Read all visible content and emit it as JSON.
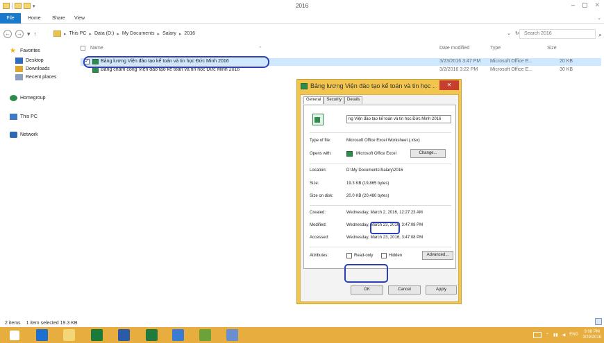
{
  "window": {
    "title": "2016",
    "minimize": "–",
    "maximize": "▢",
    "close": "✕"
  },
  "ribbon": {
    "file": "File",
    "home": "Home",
    "share": "Share",
    "view": "View",
    "expand": "⌄"
  },
  "address": {
    "crumbs": [
      "This PC",
      "Data (D:)",
      "My Documents",
      "Salary",
      "2016"
    ],
    "separator": "▸",
    "dropdown": "⌄",
    "refresh": "↻",
    "search_placeholder": "Search 2016"
  },
  "sidebar": {
    "favorites": "Favorites",
    "desktop": "Desktop",
    "downloads": "Downloads",
    "recent": "Recent places",
    "homegroup": "Homegroup",
    "thispc": "This PC",
    "network": "Network"
  },
  "columns": {
    "name": "Name",
    "date": "Date modified",
    "type": "Type",
    "size": "Size"
  },
  "files": [
    {
      "name": "Bảng lương Viện đào tạo kế toán và tin học Đức Minh 2016",
      "date": "3/23/2016 3:47 PM",
      "type": "Microsoft Office E...",
      "size": "20 KB",
      "checked": true
    },
    {
      "name": "Bảng chấm công Viện đào tạo kế toán và tin học Đức Minh 2016",
      "date": "3/2/2016 3:22 PM",
      "type": "Microsoft Office E...",
      "size": "30 KB",
      "checked": false
    }
  ],
  "dialog": {
    "title": "Bảng lương Viện đào tạo kế toán và tin học ...",
    "close": "✕",
    "tabs": [
      "General",
      "Security",
      "Details"
    ],
    "filename": "ng Viện đào tạo kế toán và tin học Đức Minh 2016",
    "type_label": "Type of file:",
    "type_value": "Microsoft Office Excel Worksheet (.xlsx)",
    "opens_label": "Opens with:",
    "opens_value": "Microsoft Office Excel",
    "change_button": "Change...",
    "location_label": "Location:",
    "location_value": "D:\\My Documents\\Salary\\2016",
    "size_label": "Size:",
    "size_value": "19.3 KB (19,865 bytes)",
    "sizeondisk_label": "Size on disk:",
    "sizeondisk_value": "20.0 KB (20,480 bytes)",
    "created_label": "Created:",
    "created_value": "Wednesday, March 2, 2016, 12:27:23 AM",
    "modified_label": "Modified:",
    "modified_value": "Wednesday, March 23, 2016, 3:47:08 PM",
    "accessed_label": "Accessed:",
    "accessed_value": "Wednesday, March 23, 2016, 3:47:08 PM",
    "attributes_label": "Attributes:",
    "readonly_label": "Read-only",
    "hidden_label": "Hidden",
    "advanced_button": "Advanced...",
    "ok_button": "OK",
    "cancel_button": "Cancel",
    "apply_button": "Apply"
  },
  "status": {
    "items": "2 items",
    "selected": "1 item selected  19.3 KB"
  },
  "taskbar": {
    "lang": "ENG",
    "time": "9:08 PM",
    "date": "3/29/2016"
  }
}
